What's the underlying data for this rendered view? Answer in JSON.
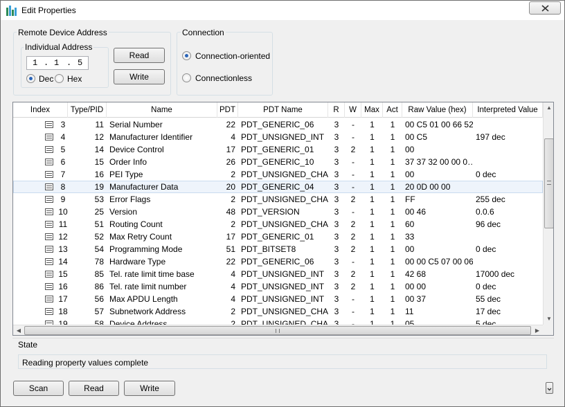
{
  "window": {
    "title": "Edit Properties",
    "close_label": "✕"
  },
  "remote_device": {
    "group_label": "Remote Device Address",
    "individual_label": "Individual Address",
    "address_parts": [
      "1",
      ".",
      "1",
      ".",
      "5"
    ],
    "dec_label": "Dec",
    "hex_label": "Hex",
    "selected_format": "Dec",
    "read_label": "Read",
    "write_label": "Write"
  },
  "connection": {
    "group_label": "Connection",
    "oriented_label": "Connection-oriented",
    "connectionless_label": "Connectionless",
    "selected": "Connection-oriented"
  },
  "table": {
    "headers": [
      "Index",
      "Type/PID",
      "Name",
      "PDT",
      "PDT Name",
      "R",
      "W",
      "Max",
      "Act",
      "Raw Value (hex)",
      "Interpreted Value"
    ],
    "selected_row_index": 5,
    "rows": [
      {
        "index": "3",
        "pid": "11",
        "name": "Serial Number",
        "pdt": "22",
        "pdt_name": "PDT_GENERIC_06",
        "r": "3",
        "w": "-",
        "max": "1",
        "act": "1",
        "raw": "00 C5 01 00 66 52",
        "interp": ""
      },
      {
        "index": "4",
        "pid": "12",
        "name": "Manufacturer Identifier",
        "pdt": "4",
        "pdt_name": "PDT_UNSIGNED_INT",
        "r": "3",
        "w": "-",
        "max": "1",
        "act": "1",
        "raw": "00 C5",
        "interp": "197 dec"
      },
      {
        "index": "5",
        "pid": "14",
        "name": "Device Control",
        "pdt": "17",
        "pdt_name": "PDT_GENERIC_01",
        "r": "3",
        "w": "2",
        "max": "1",
        "act": "1",
        "raw": "00",
        "interp": ""
      },
      {
        "index": "6",
        "pid": "15",
        "name": "Order Info",
        "pdt": "26",
        "pdt_name": "PDT_GENERIC_10",
        "r": "3",
        "w": "-",
        "max": "1",
        "act": "1",
        "raw": "37 37 32 00 00 0…",
        "interp": ""
      },
      {
        "index": "7",
        "pid": "16",
        "name": "PEI Type",
        "pdt": "2",
        "pdt_name": "PDT_UNSIGNED_CHAR",
        "r": "3",
        "w": "-",
        "max": "1",
        "act": "1",
        "raw": "00",
        "interp": "0 dec"
      },
      {
        "index": "8",
        "pid": "19",
        "name": "Manufacturer Data",
        "pdt": "20",
        "pdt_name": "PDT_GENERIC_04",
        "r": "3",
        "w": "-",
        "max": "1",
        "act": "1",
        "raw": "20 0D 00 00",
        "interp": ""
      },
      {
        "index": "9",
        "pid": "53",
        "name": "Error Flags",
        "pdt": "2",
        "pdt_name": "PDT_UNSIGNED_CHAR",
        "r": "3",
        "w": "2",
        "max": "1",
        "act": "1",
        "raw": "FF",
        "interp": "255 dec"
      },
      {
        "index": "10",
        "pid": "25",
        "name": "Version",
        "pdt": "48",
        "pdt_name": "PDT_VERSION",
        "r": "3",
        "w": "-",
        "max": "1",
        "act": "1",
        "raw": "00 46",
        "interp": "0.0.6"
      },
      {
        "index": "11",
        "pid": "51",
        "name": "Routing Count",
        "pdt": "2",
        "pdt_name": "PDT_UNSIGNED_CHAR",
        "r": "3",
        "w": "2",
        "max": "1",
        "act": "1",
        "raw": "60",
        "interp": "96 dec"
      },
      {
        "index": "12",
        "pid": "52",
        "name": "Max Retry Count",
        "pdt": "17",
        "pdt_name": "PDT_GENERIC_01",
        "r": "3",
        "w": "2",
        "max": "1",
        "act": "1",
        "raw": "33",
        "interp": ""
      },
      {
        "index": "13",
        "pid": "54",
        "name": "Programming Mode",
        "pdt": "51",
        "pdt_name": "PDT_BITSET8",
        "r": "3",
        "w": "2",
        "max": "1",
        "act": "1",
        "raw": "00",
        "interp": "0 dec"
      },
      {
        "index": "14",
        "pid": "78",
        "name": "Hardware Type",
        "pdt": "22",
        "pdt_name": "PDT_GENERIC_06",
        "r": "3",
        "w": "-",
        "max": "1",
        "act": "1",
        "raw": "00 00 C5 07 00 06",
        "interp": ""
      },
      {
        "index": "15",
        "pid": "85",
        "name": "Tel. rate limit time base",
        "pdt": "4",
        "pdt_name": "PDT_UNSIGNED_INT",
        "r": "3",
        "w": "2",
        "max": "1",
        "act": "1",
        "raw": "42 68",
        "interp": "17000 dec"
      },
      {
        "index": "16",
        "pid": "86",
        "name": "Tel. rate limit number",
        "pdt": "4",
        "pdt_name": "PDT_UNSIGNED_INT",
        "r": "3",
        "w": "2",
        "max": "1",
        "act": "1",
        "raw": "00 00",
        "interp": "0 dec"
      },
      {
        "index": "17",
        "pid": "56",
        "name": "Max APDU Length",
        "pdt": "4",
        "pdt_name": "PDT_UNSIGNED_INT",
        "r": "3",
        "w": "-",
        "max": "1",
        "act": "1",
        "raw": "00 37",
        "interp": "55 dec"
      },
      {
        "index": "18",
        "pid": "57",
        "name": "Subnetwork Address",
        "pdt": "2",
        "pdt_name": "PDT_UNSIGNED_CHAR",
        "r": "3",
        "w": "-",
        "max": "1",
        "act": "1",
        "raw": "11",
        "interp": "17 dec"
      },
      {
        "index": "19",
        "pid": "58",
        "name": "Device Address",
        "pdt": "2",
        "pdt_name": "PDT_UNSIGNED_CHAR",
        "r": "3",
        "w": "-",
        "max": "1",
        "act": "1",
        "raw": "05",
        "interp": "5 dec"
      }
    ]
  },
  "state": {
    "group_label": "State",
    "message": "Reading property values complete"
  },
  "footer": {
    "scan_label": "Scan",
    "read_label": "Read",
    "write_label": "Write"
  }
}
